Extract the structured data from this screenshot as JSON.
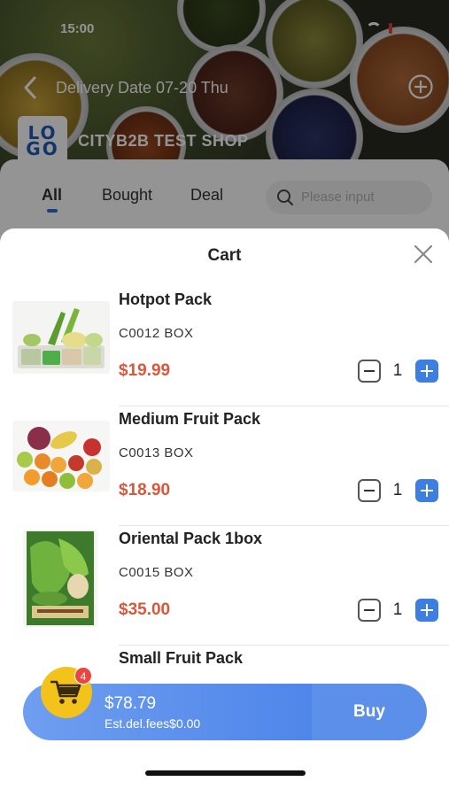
{
  "status": {
    "time": "15:00"
  },
  "topbar": {
    "delivery_label": "Delivery Date 07-20 Thu"
  },
  "shop": {
    "logo_text_top": "LO",
    "logo_text_bottom": "GO",
    "name": "CITYB2B TEST SHOP"
  },
  "tabs": [
    {
      "label": "All",
      "active": true
    },
    {
      "label": "Bought",
      "active": false
    },
    {
      "label": "Deal",
      "active": false
    }
  ],
  "search": {
    "placeholder": "Please input"
  },
  "cart": {
    "title": "Cart",
    "items": [
      {
        "name": "Hotpot Pack",
        "code": "C0012 BOX",
        "price": "$19.99",
        "qty": "1"
      },
      {
        "name": "Medium Fruit Pack",
        "code": "C0013 BOX",
        "price": "$18.90",
        "qty": "1"
      },
      {
        "name": "Oriental Pack 1box",
        "code": "C0015 BOX",
        "price": "$35.00",
        "qty": "1"
      },
      {
        "name": "Small Fruit Pack",
        "code": "",
        "price": "",
        "qty": ""
      }
    ]
  },
  "checkout": {
    "total": "$78.79",
    "fees": "Est.del.fees$0.00",
    "buy_label": "Buy",
    "badge_count": "4"
  },
  "colors": {
    "accent": "#3d7fe0",
    "price": "#d9573c",
    "cart_fab": "#f3c21b",
    "badge": "#e8463f"
  }
}
